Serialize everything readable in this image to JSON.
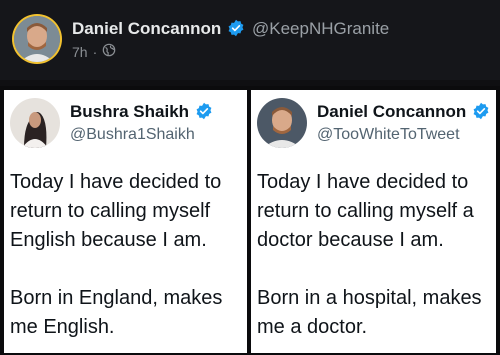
{
  "header": {
    "display_name": "Daniel Concannon",
    "handle": "@KeepNHGranite",
    "time": "7h",
    "separator": "·",
    "visibility_icon": "globe-icon"
  },
  "embedded_tweets": [
    {
      "display_name": "Bushra Shaikh",
      "handle": "@Bushra1Shaikh",
      "verified": true,
      "paragraphs": [
        "Today I have decided to return to calling myself English because I am.",
        "Born in England, makes me English."
      ]
    },
    {
      "display_name": "Daniel Concannon",
      "handle": "@TooWhiteToTweet",
      "verified": true,
      "paragraphs": [
        "Today I have decided to return to calling myself a doctor because I am.",
        "Born in a hospital, makes me a doctor."
      ]
    }
  ],
  "colors": {
    "verified_badge": "#1d9bf0",
    "avatar_ring": "#f2c230",
    "background": "#15161a"
  }
}
